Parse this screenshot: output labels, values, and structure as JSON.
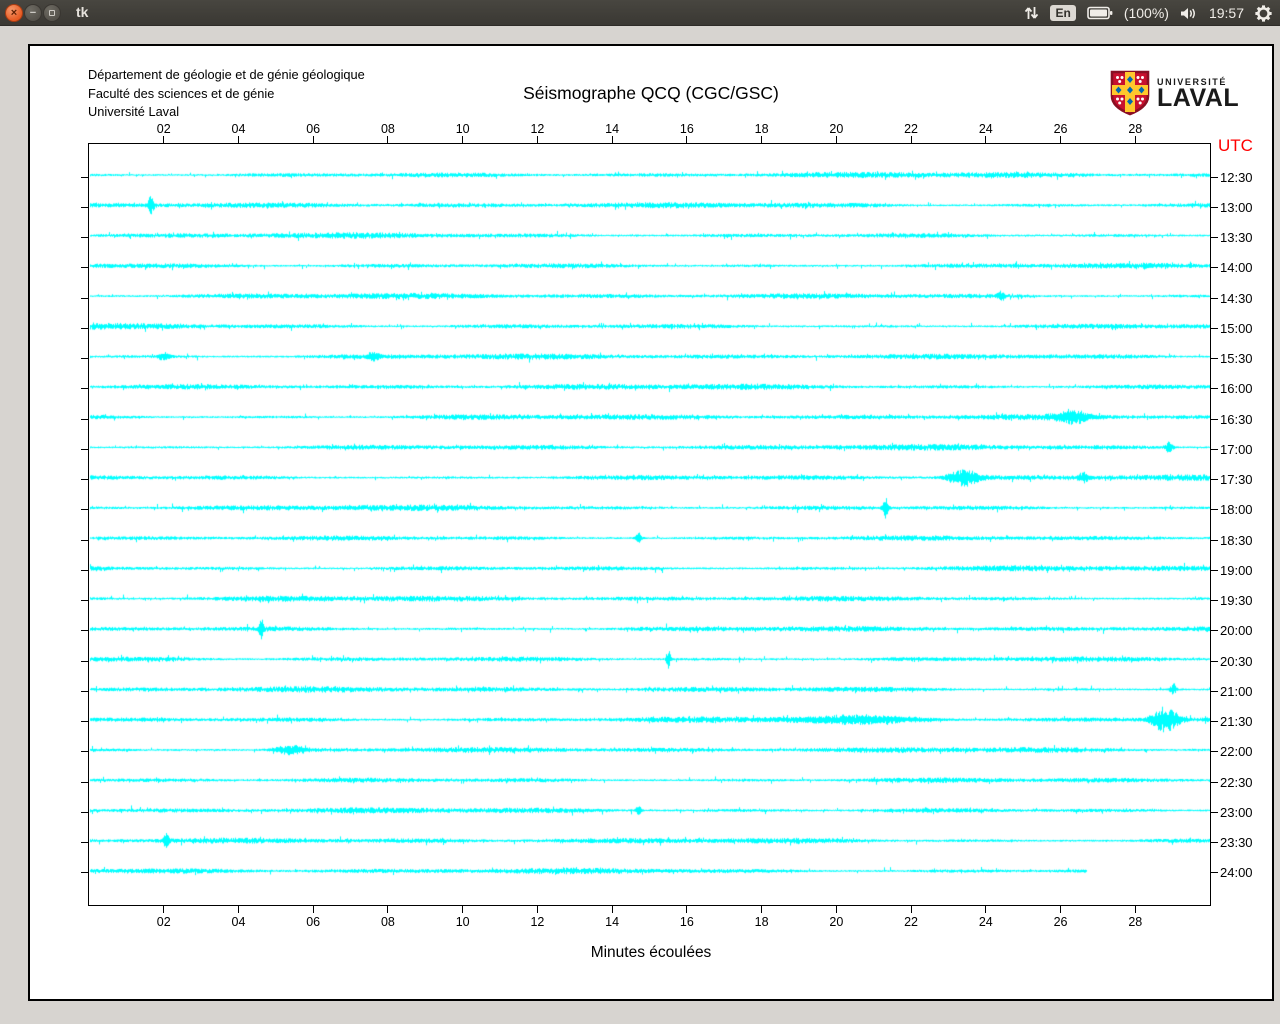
{
  "titlebar": {
    "title": "tk"
  },
  "tray": {
    "keyboard_label": "En",
    "battery_label": "(100%)",
    "clock": "19:57"
  },
  "document": {
    "org_lines": [
      "Département de géologie et de génie géologique",
      "Faculté des sciences et de génie",
      "Université Laval"
    ],
    "title": "Séismographe QCQ (CGC/GSC)",
    "logo": {
      "word1": "UNIVERSITÉ",
      "word2": "LAVAL"
    },
    "utc_label": "UTC",
    "xlabel": "Minutes écoulées"
  },
  "colors": {
    "trace": "#00ffff",
    "utc_label": "#ff0000",
    "panel": "#3a3833",
    "page_bg": "#ffffff",
    "desktop_bg": "#d7d4d0"
  },
  "chart_data": {
    "type": "line",
    "title": "Séismographe QCQ (CGC/GSC)",
    "xlabel": "Minutes écoulées",
    "y_axis_title": "UTC",
    "x_range_minutes": [
      0,
      30
    ],
    "x_tick_minutes": [
      2,
      4,
      6,
      8,
      10,
      12,
      14,
      16,
      18,
      20,
      22,
      24,
      26,
      28
    ],
    "x_tick_labels": [
      "02",
      "04",
      "06",
      "08",
      "10",
      "12",
      "14",
      "16",
      "18",
      "20",
      "22",
      "24",
      "26",
      "28"
    ],
    "grid": false,
    "trace_color": "#00ffff",
    "rows": [
      {
        "utc": "12:30",
        "end_minute": 30,
        "events": []
      },
      {
        "utc": "13:00",
        "end_minute": 30,
        "events": [
          {
            "minute": 1.65,
            "amp": 9,
            "w": 0.06
          }
        ]
      },
      {
        "utc": "13:30",
        "end_minute": 30,
        "events": []
      },
      {
        "utc": "14:00",
        "end_minute": 30,
        "events": []
      },
      {
        "utc": "14:30",
        "end_minute": 30,
        "events": [
          {
            "minute": 24.4,
            "amp": 5,
            "w": 0.06
          }
        ]
      },
      {
        "utc": "15:00",
        "end_minute": 30,
        "events": []
      },
      {
        "utc": "15:30",
        "end_minute": 30,
        "events": [
          {
            "minute": 2.0,
            "amp": 4,
            "w": 0.1
          },
          {
            "minute": 7.6,
            "amp": 4,
            "w": 0.1
          }
        ]
      },
      {
        "utc": "16:00",
        "end_minute": 30,
        "events": []
      },
      {
        "utc": "16:30",
        "end_minute": 30,
        "events": [
          {
            "minute": 26.3,
            "amp": 6,
            "w": 0.3
          }
        ]
      },
      {
        "utc": "17:00",
        "end_minute": 30,
        "events": [
          {
            "minute": 28.9,
            "amp": 6,
            "w": 0.07
          }
        ]
      },
      {
        "utc": "17:30",
        "end_minute": 30,
        "events": [
          {
            "minute": 23.4,
            "amp": 8,
            "w": 0.3
          },
          {
            "minute": 26.6,
            "amp": 5,
            "w": 0.1
          }
        ]
      },
      {
        "utc": "18:00",
        "end_minute": 30,
        "events": [
          {
            "minute": 21.3,
            "amp": 11,
            "w": 0.05
          }
        ]
      },
      {
        "utc": "18:30",
        "end_minute": 30,
        "events": [
          {
            "minute": 14.7,
            "amp": 5,
            "w": 0.06
          }
        ]
      },
      {
        "utc": "19:00",
        "end_minute": 30,
        "events": []
      },
      {
        "utc": "19:30",
        "end_minute": 30,
        "events": []
      },
      {
        "utc": "20:00",
        "end_minute": 30,
        "events": [
          {
            "minute": 4.6,
            "amp": 11,
            "w": 0.04
          }
        ]
      },
      {
        "utc": "20:30",
        "end_minute": 30,
        "events": [
          {
            "minute": 15.5,
            "amp": 12,
            "w": 0.04
          }
        ]
      },
      {
        "utc": "21:00",
        "end_minute": 30,
        "events": [
          {
            "minute": 29.0,
            "amp": 6,
            "w": 0.06
          }
        ]
      },
      {
        "utc": "21:30",
        "end_minute": 30,
        "events": [
          {
            "minute": 20.5,
            "amp": 3,
            "w": 1.2
          },
          {
            "minute": 28.8,
            "amp": 13,
            "w": 0.25
          }
        ]
      },
      {
        "utc": "22:00",
        "end_minute": 30,
        "events": [
          {
            "minute": 5.4,
            "amp": 4,
            "w": 0.3
          }
        ]
      },
      {
        "utc": "22:30",
        "end_minute": 30,
        "events": []
      },
      {
        "utc": "23:00",
        "end_minute": 30,
        "events": [
          {
            "minute": 14.7,
            "amp": 7,
            "w": 0.05
          }
        ]
      },
      {
        "utc": "23:30",
        "end_minute": 30,
        "events": [
          {
            "minute": 2.05,
            "amp": 8,
            "w": 0.05
          }
        ]
      },
      {
        "utc": "24:00",
        "end_minute": 26.7,
        "events": []
      }
    ]
  }
}
